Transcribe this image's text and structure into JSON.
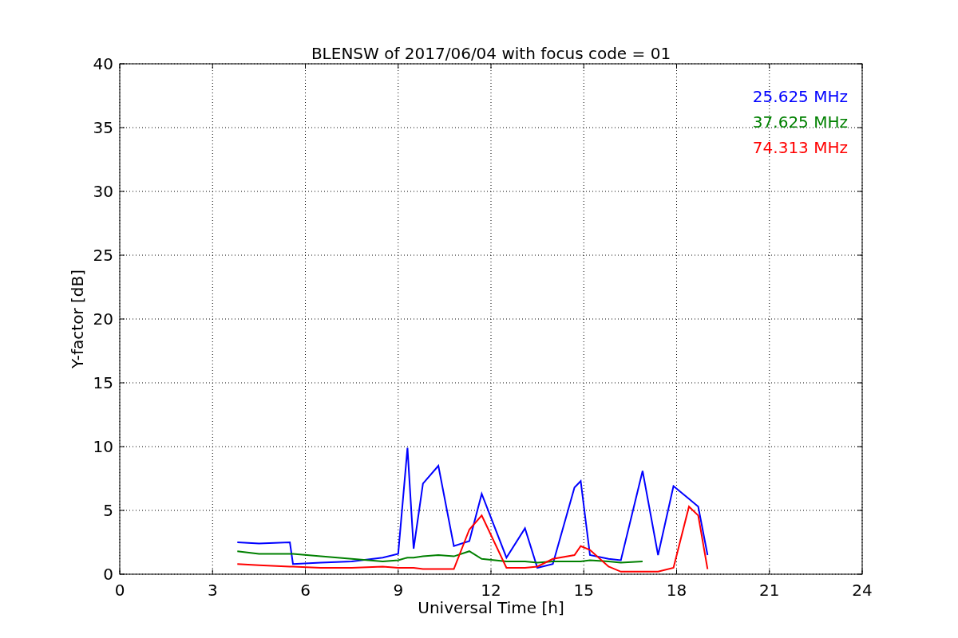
{
  "chart_data": {
    "type": "line",
    "title": "BLENSW of 2017/06/04 with focus code = 01",
    "xlabel": "Universal Time [h]",
    "ylabel": "Y-factor [dB]",
    "x": [
      3.8,
      4.5,
      5.5,
      5.6,
      6.5,
      7.5,
      8.5,
      9.0,
      9.3,
      9.5,
      9.8,
      10.3,
      10.8,
      11.3,
      11.7,
      12.5,
      13.1,
      13.5,
      14.0,
      14.7,
      14.9,
      15.2,
      15.8,
      16.2,
      16.9,
      17.4,
      17.9,
      18.4,
      18.7,
      19.0
    ],
    "series": [
      {
        "name": "25.625 MHz",
        "color": "#0000ff",
        "values": [
          2.5,
          2.4,
          2.5,
          0.8,
          0.9,
          1.0,
          1.3,
          1.6,
          9.9,
          2.0,
          7.1,
          8.5,
          2.2,
          2.6,
          6.3,
          1.3,
          3.6,
          0.5,
          0.8,
          6.8,
          7.3,
          1.5,
          1.2,
          1.1,
          8.1,
          1.5,
          6.9,
          5.9,
          5.3,
          1.5
        ]
      },
      {
        "name": "37.625 MHz",
        "color": "#008000",
        "values": [
          1.8,
          1.6,
          1.6,
          1.6,
          1.4,
          1.2,
          1.0,
          1.1,
          1.3,
          1.3,
          1.4,
          1.5,
          1.4,
          1.8,
          1.2,
          1.0,
          1.0,
          0.9,
          1.0,
          1.0,
          1.0,
          1.1,
          1.0,
          0.9,
          1.0,
          null,
          null,
          null,
          null,
          null
        ]
      },
      {
        "name": "74.313 MHz",
        "color": "#ff0000",
        "values": [
          0.8,
          0.7,
          0.6,
          0.6,
          0.5,
          0.5,
          0.6,
          0.5,
          0.5,
          0.5,
          0.4,
          0.4,
          0.4,
          3.5,
          4.6,
          0.5,
          0.5,
          0.6,
          1.2,
          1.5,
          2.2,
          1.9,
          0.6,
          0.2,
          0.2,
          0.2,
          0.5,
          5.3,
          4.6,
          0.4
        ]
      }
    ],
    "grid": true,
    "xlim": [
      0,
      24
    ],
    "ylim": [
      0,
      40
    ],
    "xticks": [
      0,
      3,
      6,
      9,
      12,
      15,
      18,
      21,
      24
    ],
    "yticks": [
      0,
      5,
      10,
      15,
      20,
      25,
      30,
      35,
      40
    ]
  }
}
